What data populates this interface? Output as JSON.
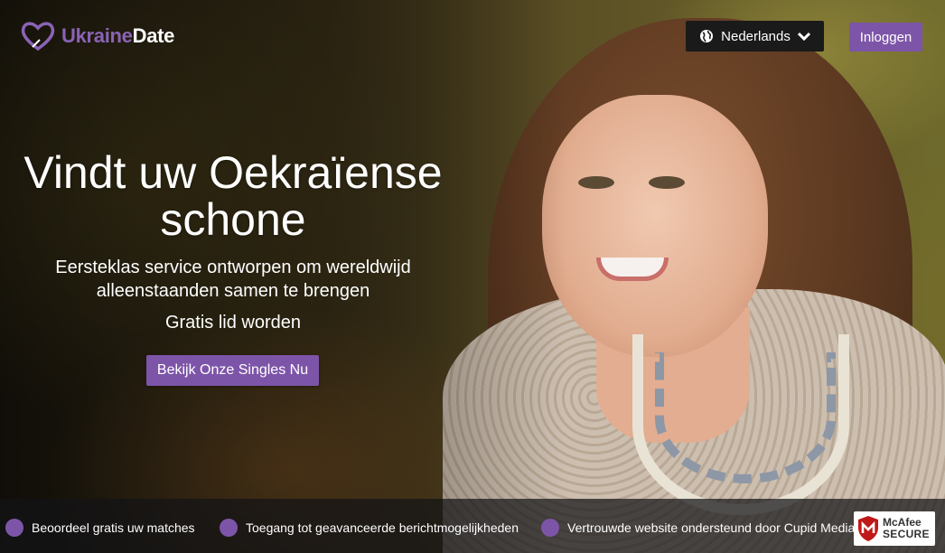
{
  "header": {
    "logo_part1": "Ukraine",
    "logo_part2": "Date",
    "language_label": "Nederlands",
    "login_label": "Inloggen"
  },
  "hero": {
    "headline_line1": "Vindt uw Oekraïense",
    "headline_line2": "schone",
    "subheading_line1": "Eersteklas service ontworpen om wereldwijd",
    "subheading_line2": "alleenstaanden samen te brengen",
    "join_text": "Gratis lid worden",
    "cta_label": "Bekijk Onze Singles Nu"
  },
  "features": [
    {
      "label": "Beoordeel gratis uw matches"
    },
    {
      "label": "Toegang tot geavanceerde berichtmogelijkheden"
    },
    {
      "label": "Vertrouwde website ondersteund door Cupid Media"
    }
  ],
  "badge": {
    "line1": "McAfee",
    "line2": "SECURE"
  },
  "icons": {
    "logo": "heart-logo-icon",
    "language": "globe-icon",
    "dropdown": "chevron-down-icon",
    "feature_bullet": "circle-bullet-icon",
    "badge": "mcafee-shield-icon"
  },
  "colors": {
    "accent": "#7d55a8",
    "logo_accent": "#8a63b6",
    "language_button_bg": "#1a1a1a",
    "bar_bg": "#141416"
  }
}
